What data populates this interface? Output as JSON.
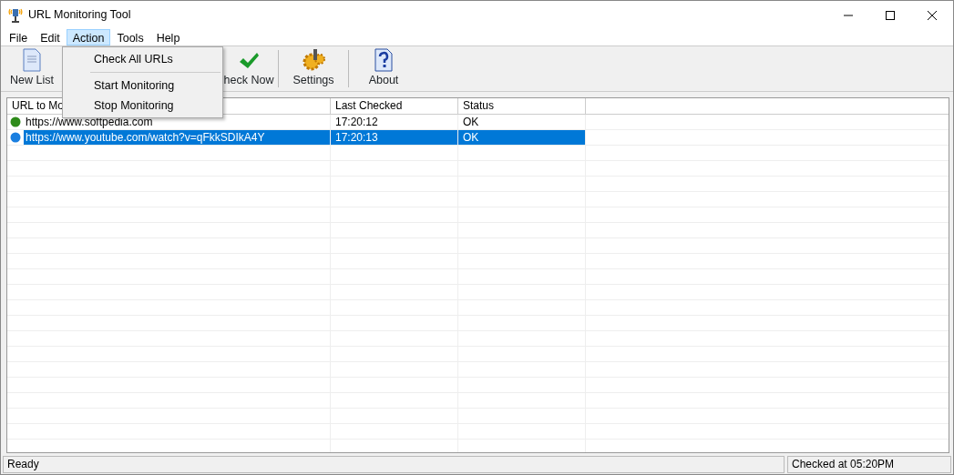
{
  "window": {
    "title": "URL Monitoring Tool"
  },
  "menu": [
    {
      "label": "File",
      "selected": false
    },
    {
      "label": "Edit",
      "selected": false
    },
    {
      "label": "Action",
      "selected": true
    },
    {
      "label": "Tools",
      "selected": false
    },
    {
      "label": "Help",
      "selected": false
    }
  ],
  "toolbar": [
    {
      "label": "New List",
      "kind": "document"
    },
    {
      "label": "heck Now",
      "kind": "check"
    },
    {
      "label": "Settings",
      "kind": "gear"
    },
    {
      "label": "About",
      "kind": "help"
    }
  ],
  "dropdown": [
    {
      "kind": "item",
      "label": "Check All URLs"
    },
    {
      "kind": "separator"
    },
    {
      "kind": "item",
      "label": "Start Monitoring"
    },
    {
      "kind": "item",
      "label": "Stop Monitoring"
    }
  ],
  "table": {
    "columns": [
      "URL to Mo",
      "Last Checked",
      "Status"
    ],
    "rows": [
      {
        "color": "#2e8b1a",
        "cells": [
          "https://www.softpedia.com",
          "17:20:12",
          "OK"
        ],
        "selected": false
      },
      {
        "color": "#1a7fe0",
        "cells": [
          "https://www.youtube.com/watch?v=qFkkSDIkA4Y",
          "17:20:13",
          "OK"
        ],
        "selected": true
      }
    ]
  },
  "status_bar": [
    "Ready",
    "Checked at 05:20PM"
  ]
}
